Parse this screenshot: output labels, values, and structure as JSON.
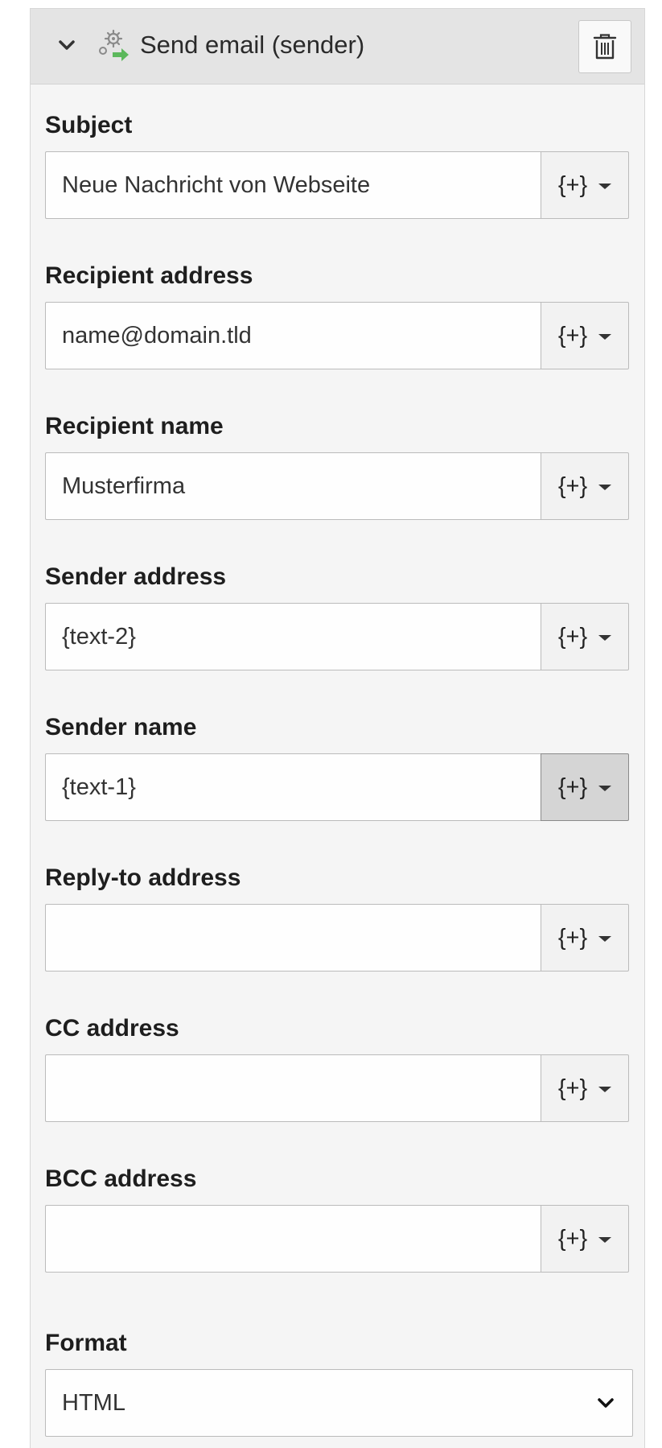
{
  "header": {
    "title": "Send email (sender)",
    "collapse_icon": "chevron-down-icon",
    "action_icon": "finisher-gear-arrow-icon",
    "delete_icon": "trash-icon"
  },
  "fields": [
    {
      "label": "Subject",
      "value": "Neue Nachricht von Webseite",
      "button": "{+}"
    },
    {
      "label": "Recipient address",
      "value": "name@domain.tld",
      "button": "{+}"
    },
    {
      "label": "Recipient name",
      "value": "Musterfirma",
      "button": "{+}"
    },
    {
      "label": "Sender address",
      "value": "{text-2}",
      "button": "{+}"
    },
    {
      "label": "Sender name",
      "value": "{text-1}",
      "button": "{+}",
      "active": true
    },
    {
      "label": "Reply-to address",
      "value": "",
      "button": "{+}"
    },
    {
      "label": "CC address",
      "value": "",
      "button": "{+}"
    },
    {
      "label": "BCC address",
      "value": "",
      "button": "{+}"
    }
  ],
  "format": {
    "label": "Format",
    "value": "HTML"
  },
  "colors": {
    "panel_bg": "#f5f5f5",
    "header_bg": "#e4e4e4",
    "active_button_bg": "#d5d5d5",
    "icon_green": "#5cb85c"
  }
}
